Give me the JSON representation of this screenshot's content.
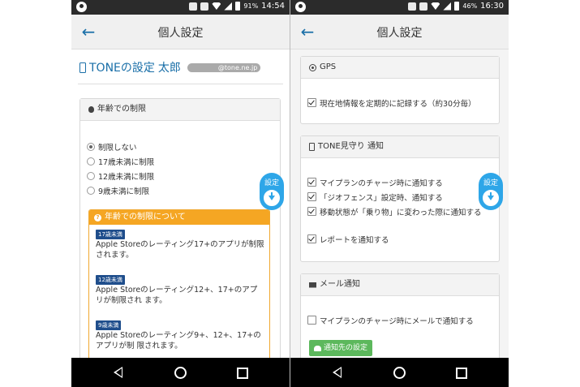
{
  "left": {
    "status": {
      "battery": "91%",
      "time": "14:54"
    },
    "title": "個人設定",
    "user": {
      "prefix": "TONEの設定",
      "name": "太郎",
      "email": "@tone.ne.jp"
    },
    "age_panel": {
      "heading": "年齢での制限",
      "options": [
        {
          "label": "制限しない",
          "selected": true
        },
        {
          "label": "17歳未満に制限",
          "selected": false
        },
        {
          "label": "12歳未満に制限",
          "selected": false
        },
        {
          "label": "9歳未満に制限",
          "selected": false
        }
      ],
      "info": {
        "heading": "年齢での制限について",
        "items": [
          {
            "badge": "17歳未満",
            "desc": "Apple Storeのレーティング17+のアプリが制限されます。"
          },
          {
            "badge": "12歳未満",
            "desc": "Apple Storeのレーティング12+、17+のアプリが制限され ます。"
          },
          {
            "badge": "9歳未満",
            "desc": "Apple Storeのレーティング9+、12+、17+のアプリが制 限されます。"
          }
        ]
      }
    },
    "fab_label": "設定"
  },
  "right": {
    "status": {
      "battery": "46%",
      "time": "16:30"
    },
    "title": "個人設定",
    "gps_panel": {
      "heading": "GPS",
      "items": [
        {
          "label": "現在地情報を定期的に記録する（約30分毎）",
          "checked": true
        }
      ]
    },
    "watch_panel": {
      "heading": "TONE見守り 通知",
      "items": [
        {
          "label": "マイプランのチャージ時に通知する",
          "checked": true
        },
        {
          "label": "「ジオフェンス」設定時、通知する",
          "checked": true
        },
        {
          "label": "移動状態が「乗り物」に変わった際に通知する",
          "checked": true
        },
        {
          "label": "レポートを通知する",
          "checked": true
        }
      ]
    },
    "mail_panel": {
      "heading": "メール通知",
      "items": [
        {
          "label": "マイプランのチャージ時にメールで通知する",
          "checked": false
        }
      ],
      "button": "通知先の設定"
    },
    "fab_label": "設定"
  },
  "colors": {
    "accent": "#1a6fa8",
    "fab": "#2ea6e8",
    "info": "#f5a623",
    "badge": "#1f4e8c",
    "button": "#5cb85c"
  }
}
